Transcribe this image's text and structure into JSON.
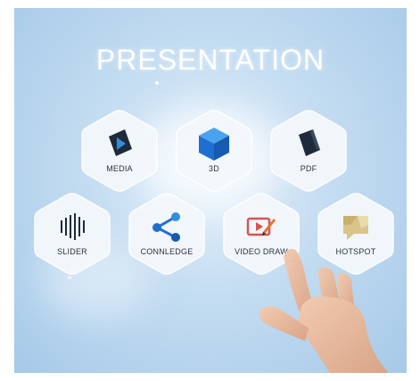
{
  "screen": {
    "title": "PRESENTATION"
  },
  "tiles": [
    {
      "label": "MEDIA",
      "icon": "media-icon"
    },
    {
      "label": "3D",
      "icon": "cube-3d-icon"
    },
    {
      "label": "PDF",
      "icon": "pdf-icon"
    },
    {
      "label": "SLIDER",
      "icon": "slider-bars-icon"
    },
    {
      "label": "CONNLEDGE",
      "icon": "share-network-icon"
    },
    {
      "label": "VIDEO DRAW",
      "icon": "video-draw-icon"
    },
    {
      "label": "HOTSPOT",
      "icon": "hotspot-icon"
    }
  ],
  "colors": {
    "background": "#b8d5ee",
    "tile": "#f4f8fc",
    "cube_blue": "#1f6fd0",
    "dark_navy": "#1f2a3a",
    "video_red": "#d9534f",
    "hotspot_gold": "#d8c58b"
  }
}
